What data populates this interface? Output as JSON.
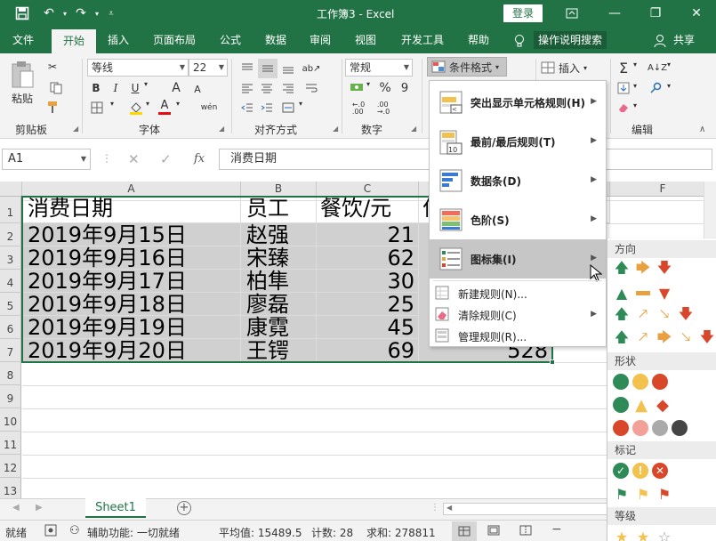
{
  "window": {
    "title": "工作簿3 - Excel",
    "login_label": "登录",
    "minimize": "—",
    "restore": "❐",
    "close": "✕"
  },
  "ribbon_tabs": [
    "文件",
    "开始",
    "插入",
    "页面布局",
    "公式",
    "数据",
    "审阅",
    "视图",
    "开发工具",
    "帮助"
  ],
  "tell_me": "操作说明搜索",
  "share": "共享",
  "clipboard": {
    "paste": "粘贴",
    "group": "剪贴板"
  },
  "font": {
    "name": "等线",
    "size": "22",
    "group": "字体",
    "bold": "B",
    "italic": "I",
    "underline": "U",
    "grow": "A",
    "shrink": "A",
    "wen": "wén",
    "font_color_letter": "A"
  },
  "alignment": {
    "group": "对齐方式"
  },
  "number": {
    "format": "常规",
    "group": "数字",
    "percent": "%",
    "comma": "9"
  },
  "styles": {
    "cond_format": "条件格式",
    "insert": "插入"
  },
  "editing": {
    "group": "编辑",
    "sum": "Σ"
  },
  "formula_bar": {
    "name_box": "A1",
    "fx": "fx",
    "content": "消费日期"
  },
  "columns": [
    "A",
    "B",
    "C",
    "F"
  ],
  "rows": [
    "1",
    "2",
    "3",
    "4",
    "5",
    "6",
    "7",
    "8",
    "9",
    "10",
    "11",
    "12",
    "13"
  ],
  "table": {
    "headers": [
      "消费日期",
      "员工",
      "餐饮/元",
      "住"
    ],
    "rows": [
      [
        "2019年9月15日",
        "赵强",
        "21"
      ],
      [
        "2019年9月16日",
        "宋臻",
        "62"
      ],
      [
        "2019年9月17日",
        "柏隼",
        "30"
      ],
      [
        "2019年9月18日",
        "廖磊",
        "25"
      ],
      [
        "2019年9月19日",
        "康霓",
        "45"
      ],
      [
        "2019年9月20日",
        "王锷",
        "69"
      ]
    ],
    "extra_value": "528"
  },
  "cf_menu": {
    "items": [
      {
        "label": "突出显示单元格规则(H)",
        "has_sub": true
      },
      {
        "label": "最前/最后规则(T)",
        "has_sub": true
      },
      {
        "label": "数据条(D)",
        "has_sub": true
      },
      {
        "label": "色阶(S)",
        "has_sub": true
      },
      {
        "label": "图标集(I)",
        "has_sub": true
      }
    ],
    "small_items": [
      {
        "label": "新建规则(N)..."
      },
      {
        "label": "清除规则(C)"
      },
      {
        "label": "管理规则(R)..."
      }
    ]
  },
  "icon_submenu": {
    "sections": [
      "方向",
      "形状",
      "标记",
      "等级"
    ]
  },
  "sheet": {
    "tab": "Sheet1",
    "add": "+"
  },
  "status": {
    "ready": "就绪",
    "accessibility": "辅助功能: 一切就绪",
    "average": "平均值: 15489.5",
    "count": "计数: 28",
    "sum": "求和: 278811"
  },
  "colors": {
    "excel_green": "#217346",
    "selection_gray": "#d0d0d0",
    "menu_highlight": "#c6c6c6",
    "arrow_green": "#2e8b57",
    "arrow_orange": "#e8a040",
    "arrow_red": "#d9472b"
  }
}
